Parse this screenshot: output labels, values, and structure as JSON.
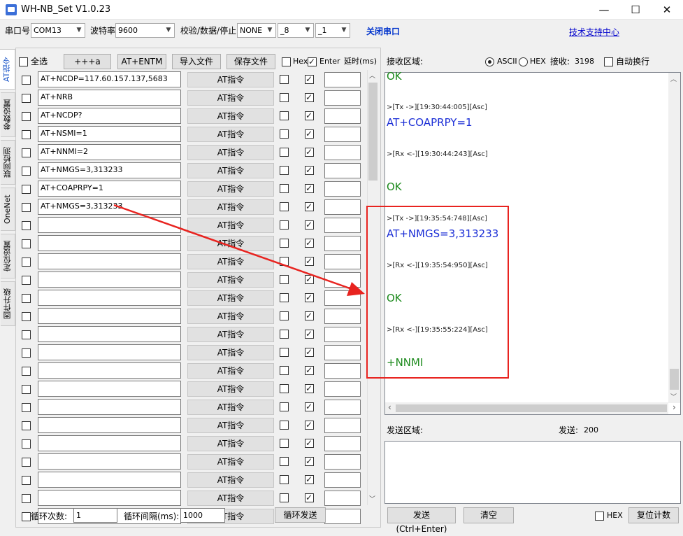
{
  "window": {
    "title": "WH-NB_Set V1.0.23",
    "minimize": "—",
    "maximize": "☐",
    "close": "✕"
  },
  "toolbar": {
    "port_label": "串口号",
    "port_value": "COM13",
    "baud_label": "波特率",
    "baud_value": "9600",
    "parity_label": "校验/数据/停止",
    "parity_value": "NONE",
    "data_bits_value": "_8",
    "stop_bits_value": "_1",
    "close_port": "关闭串口",
    "support_link": "技术支持中心"
  },
  "vtabs": [
    "AT指令",
    "参数设置",
    "联网检测",
    "OneNet",
    "定位设置",
    "固件升级"
  ],
  "left_header": {
    "select_all": "全选",
    "btn_plus": "+++a",
    "btn_entm": "AT+ENTM",
    "btn_import": "导入文件",
    "btn_save": "保存文件",
    "hex_label": "Hex",
    "enter_label": "Enter",
    "delay_label": "延时(ms)"
  },
  "commands": [
    {
      "text": "AT+NCDP=117.60.157.137,5683",
      "hex": false,
      "enter": true
    },
    {
      "text": "AT+NRB",
      "hex": false,
      "enter": true
    },
    {
      "text": "AT+NCDP?",
      "hex": false,
      "enter": true
    },
    {
      "text": "AT+NSMI=1",
      "hex": false,
      "enter": true
    },
    {
      "text": "AT+NNMI=2",
      "hex": false,
      "enter": true
    },
    {
      "text": "AT+NMGS=3,313233",
      "hex": false,
      "enter": true
    },
    {
      "text": "AT+COAPRPY=1",
      "hex": false,
      "enter": true
    },
    {
      "text": "AT+NMGS=3,313233",
      "hex": false,
      "enter": true
    },
    {
      "text": "",
      "hex": false,
      "enter": true
    },
    {
      "text": "",
      "hex": false,
      "enter": true
    },
    {
      "text": "",
      "hex": false,
      "enter": true
    },
    {
      "text": "",
      "hex": false,
      "enter": true
    },
    {
      "text": "",
      "hex": false,
      "enter": true
    },
    {
      "text": "",
      "hex": false,
      "enter": true
    },
    {
      "text": "",
      "hex": false,
      "enter": true
    },
    {
      "text": "",
      "hex": false,
      "enter": true
    },
    {
      "text": "",
      "hex": false,
      "enter": true
    },
    {
      "text": "",
      "hex": false,
      "enter": true
    },
    {
      "text": "",
      "hex": false,
      "enter": true
    },
    {
      "text": "",
      "hex": false,
      "enter": true
    },
    {
      "text": "",
      "hex": false,
      "enter": true
    },
    {
      "text": "",
      "hex": false,
      "enter": true
    },
    {
      "text": "",
      "hex": false,
      "enter": true
    },
    {
      "text": "",
      "hex": false,
      "enter": true
    },
    {
      "text": "",
      "hex": false,
      "enter": true
    }
  ],
  "at_button_label": "AT指令",
  "left_footer": {
    "loop_count_label": "循环次数:",
    "loop_count_value": "1",
    "loop_interval_label": "循环间隔(ms):",
    "loop_interval_value": "1000",
    "loop_send": "循环发送"
  },
  "receive": {
    "label": "接收区域:",
    "ascii_label": "ASCII",
    "hex_label": "HEX",
    "mode": "ASCII",
    "count_label": "接收:",
    "count_value": "3198",
    "autowrap_label": "自动换行",
    "log": [
      {
        "kind": "ok",
        "text": "OK"
      },
      {
        "kind": "meta",
        "text": ">[Tx ->][19:30:44:005][Asc]"
      },
      {
        "kind": "tx",
        "text": "AT+COAPRPY=1"
      },
      {
        "kind": "meta",
        "text": ">[Rx <-][19:30:44:243][Asc]"
      },
      {
        "kind": "ok",
        "text": "OK"
      },
      {
        "kind": "meta",
        "text": ">[Tx ->][19:35:54:748][Asc]"
      },
      {
        "kind": "tx",
        "text": "AT+NMGS=3,313233"
      },
      {
        "kind": "meta",
        "text": ">[Rx <-][19:35:54:950][Asc]"
      },
      {
        "kind": "ok",
        "text": "OK"
      },
      {
        "kind": "meta",
        "text": ">[Rx <-][19:35:55:224][Asc]"
      },
      {
        "kind": "ok",
        "text": "+NNMI"
      }
    ]
  },
  "send": {
    "label": "发送区域:",
    "count_label": "发送:",
    "count_value": "200",
    "send_button": "发送(Ctrl+Enter)",
    "clear_button": "清空",
    "hex_label": "HEX",
    "reset_button": "复位计数"
  },
  "colors": {
    "tx_text": "#1c2fd6",
    "ok_text": "#1c8a1c",
    "annotation": "#e8231f",
    "active_tab": "#1a55c8"
  }
}
